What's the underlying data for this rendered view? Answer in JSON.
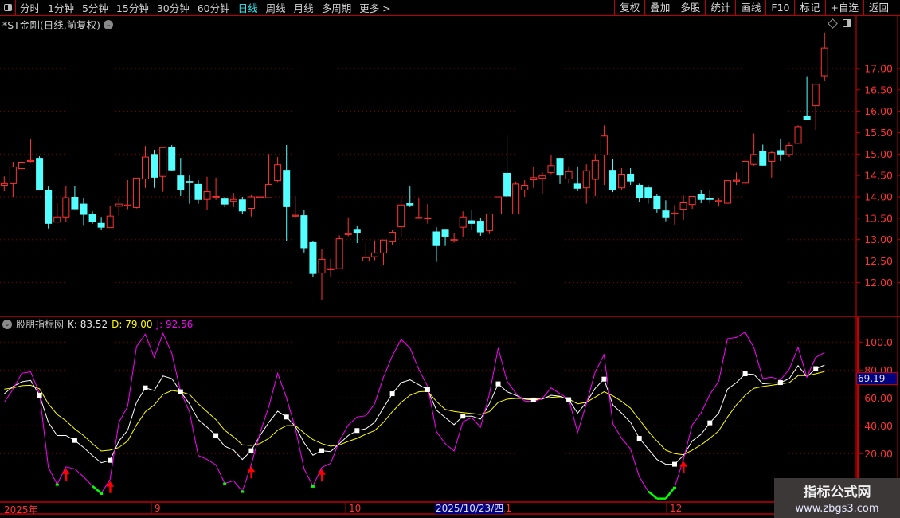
{
  "toolbar": {
    "periods": [
      "分时",
      "1分钟",
      "5分钟",
      "15分钟",
      "30分钟",
      "60分钟",
      "日线",
      "周线",
      "月线",
      "多周期",
      "更多 >"
    ],
    "active_period": "日线",
    "buttons": [
      "复权",
      "叠加",
      "多股",
      "统计",
      "画线",
      "F10",
      "标记",
      "+自选",
      "返回"
    ]
  },
  "chart_title": "*ST金刚(日线,前复权)",
  "indicator": {
    "name": "股朋指标网",
    "k_label": "K: 83.52",
    "d_label": "D: 79.00",
    "j_label": "J: 92.56"
  },
  "price_axis": [
    "17.00",
    "16.50",
    "16.00",
    "15.50",
    "15.00",
    "14.50",
    "14.00",
    "13.50",
    "13.00",
    "12.50",
    "12.00"
  ],
  "indicator_axis": [
    "100.0",
    "80.00",
    "60.00",
    "40.00",
    "20.00"
  ],
  "crosshair_value": "69.19",
  "date_axis": {
    "labels": [
      "2025年",
      "9",
      "10",
      "11",
      "12"
    ],
    "crosshair_date": "2025/10/23/四"
  },
  "watermark": {
    "title": "指标公式网",
    "url": "www.zbgs3.com"
  },
  "colors": {
    "up": "#ff3333",
    "down": "#54ffff",
    "k": "#ffffff",
    "d": "#ffff00",
    "j": "#ff00ff",
    "j_low": "#00ff00",
    "signal": "#ff0000",
    "grid": "#8b0000"
  },
  "chart_data": {
    "type": "candlestick+kdj",
    "ohlc": [
      [
        14.27,
        14.48,
        14.13,
        14.31
      ],
      [
        14.31,
        14.82,
        14.0,
        14.7
      ],
      [
        14.66,
        14.97,
        14.43,
        14.81
      ],
      [
        14.85,
        15.34,
        14.81,
        14.85
      ],
      [
        14.91,
        14.95,
        14.15,
        14.15
      ],
      [
        14.15,
        14.24,
        13.26,
        13.37
      ],
      [
        13.41,
        13.85,
        13.41,
        13.53
      ],
      [
        13.53,
        14.26,
        13.41,
        13.98
      ],
      [
        14.0,
        14.26,
        13.71,
        13.71
      ],
      [
        13.84,
        13.98,
        13.34,
        13.58
      ],
      [
        13.59,
        13.66,
        13.37,
        13.41
      ],
      [
        13.39,
        13.53,
        13.22,
        13.28
      ],
      [
        13.28,
        13.78,
        13.28,
        13.55
      ],
      [
        13.78,
        13.96,
        13.56,
        13.83
      ],
      [
        13.81,
        14.39,
        13.71,
        13.81
      ],
      [
        13.75,
        14.44,
        13.73,
        14.44
      ],
      [
        14.42,
        15.19,
        14.21,
        14.93
      ],
      [
        15.0,
        15.1,
        14.21,
        14.45
      ],
      [
        14.48,
        15.15,
        14.12,
        15.15
      ],
      [
        15.16,
        15.21,
        14.6,
        14.62
      ],
      [
        14.5,
        14.91,
        14.02,
        14.16
      ],
      [
        14.37,
        14.5,
        13.84,
        14.32
      ],
      [
        14.3,
        14.39,
        13.84,
        13.93
      ],
      [
        13.94,
        14.47,
        13.69,
        14.12
      ],
      [
        14.01,
        14.45,
        13.93,
        14.01
      ],
      [
        13.96,
        14.0,
        13.76,
        13.82
      ],
      [
        13.9,
        14.09,
        13.76,
        13.94
      ],
      [
        13.94,
        14.0,
        13.6,
        13.66
      ],
      [
        13.73,
        14.04,
        13.54,
        14.0
      ],
      [
        14.0,
        14.11,
        13.82,
        14.0
      ],
      [
        13.98,
        15.0,
        13.98,
        14.29
      ],
      [
        14.38,
        14.93,
        14.33,
        14.75
      ],
      [
        14.63,
        15.21,
        12.96,
        13.76
      ],
      [
        13.57,
        14.02,
        13.5,
        13.57
      ],
      [
        13.57,
        13.7,
        12.7,
        12.8
      ],
      [
        12.94,
        12.97,
        12.13,
        12.2
      ],
      [
        12.22,
        12.79,
        11.58,
        12.54
      ],
      [
        12.32,
        12.55,
        12.14,
        12.32
      ],
      [
        12.32,
        13.1,
        12.32,
        13.02
      ],
      [
        13.14,
        13.52,
        13.08,
        13.14
      ],
      [
        13.25,
        13.31,
        12.92,
        13.15
      ],
      [
        12.5,
        12.94,
        12.5,
        12.58
      ],
      [
        12.6,
        12.98,
        12.52,
        12.69
      ],
      [
        12.69,
        12.99,
        12.41,
        12.99
      ],
      [
        12.95,
        13.23,
        12.87,
        13.17
      ],
      [
        13.3,
        14.0,
        13.07,
        13.81
      ],
      [
        13.85,
        14.24,
        13.76,
        13.8
      ],
      [
        13.52,
        13.96,
        13.52,
        13.52
      ],
      [
        13.51,
        13.83,
        13.37,
        13.51
      ],
      [
        13.19,
        13.29,
        12.48,
        12.85
      ],
      [
        13.25,
        13.25,
        12.85,
        13.07
      ],
      [
        13.0,
        13.16,
        12.93,
        13.0
      ],
      [
        13.29,
        13.66,
        13.07,
        13.53
      ],
      [
        13.45,
        13.7,
        13.22,
        13.37
      ],
      [
        13.44,
        13.5,
        13.09,
        13.17
      ],
      [
        13.21,
        13.6,
        13.13,
        13.6
      ],
      [
        13.6,
        14.0,
        13.6,
        14.0
      ],
      [
        14.56,
        15.43,
        14.01,
        14.01
      ],
      [
        13.6,
        14.34,
        13.6,
        14.3
      ],
      [
        14.16,
        14.39,
        14.0,
        14.27
      ],
      [
        14.4,
        14.69,
        14.21,
        14.45
      ],
      [
        14.44,
        14.58,
        14.06,
        14.49
      ],
      [
        14.57,
        14.98,
        14.53,
        14.73
      ],
      [
        14.91,
        14.91,
        14.3,
        14.5
      ],
      [
        14.42,
        14.7,
        14.31,
        14.59
      ],
      [
        14.31,
        14.71,
        14.13,
        14.19
      ],
      [
        14.21,
        14.76,
        13.84,
        14.61
      ],
      [
        14.41,
        15.0,
        14.02,
        14.85
      ],
      [
        14.98,
        15.67,
        14.28,
        15.42
      ],
      [
        14.63,
        14.89,
        14.11,
        14.15
      ],
      [
        14.21,
        14.67,
        14.17,
        14.53
      ],
      [
        14.54,
        14.67,
        14.28,
        14.36
      ],
      [
        14.28,
        14.31,
        13.88,
        13.97
      ],
      [
        14.22,
        14.28,
        13.84,
        13.97
      ],
      [
        14.02,
        14.06,
        13.63,
        13.72
      ],
      [
        13.68,
        13.92,
        13.43,
        13.52
      ],
      [
        13.62,
        13.81,
        13.35,
        13.62
      ],
      [
        13.71,
        14.03,
        13.46,
        13.86
      ],
      [
        13.82,
        14.01,
        13.72,
        14.01
      ],
      [
        14.07,
        14.16,
        13.85,
        13.93
      ],
      [
        13.98,
        14.15,
        13.85,
        13.93
      ],
      [
        13.91,
        13.98,
        13.77,
        13.91
      ],
      [
        13.85,
        14.38,
        13.84,
        14.38
      ],
      [
        14.39,
        14.57,
        14.28,
        14.39
      ],
      [
        14.32,
        14.98,
        14.26,
        14.83
      ],
      [
        14.76,
        15.48,
        14.73,
        14.99
      ],
      [
        15.07,
        15.22,
        14.73,
        14.73
      ],
      [
        14.83,
        15.07,
        14.45,
        15.03
      ],
      [
        15.09,
        15.35,
        14.84,
        14.99
      ],
      [
        14.99,
        15.28,
        14.93,
        15.2
      ],
      [
        15.25,
        15.67,
        15.25,
        15.64
      ],
      [
        15.9,
        16.82,
        15.79,
        15.8
      ],
      [
        16.13,
        16.65,
        15.56,
        16.63
      ],
      [
        16.83,
        17.84,
        16.7,
        17.48
      ]
    ],
    "k": [
      63,
      68.2,
      71.6,
      72.6,
      61.9,
      42.5,
      33,
      33,
      29.5,
      24.4,
      18.7,
      13.5,
      15.2,
      29.1,
      36.8,
      56.8,
      67.2,
      65.3,
      75.8,
      73.9,
      64.4,
      55.8,
      44.4,
      39,
      33,
      25.3,
      22.5,
      15.8,
      22.1,
      33,
      42.5,
      50.5,
      46.3,
      39.6,
      27.8,
      18.9,
      22.1,
      21.5,
      27.2,
      33,
      36.6,
      37.9,
      42.5,
      53,
      63,
      71,
      73,
      69.5,
      65.9,
      51.2,
      45.9,
      40.8,
      46.9,
      46.9,
      44.8,
      55.8,
      70.1,
      64.4,
      61.9,
      59.1,
      58.5,
      59.2,
      61.9,
      61.2,
      58.7,
      49.1,
      56.8,
      66.9,
      73.5,
      54.9,
      49.1,
      42.5,
      31,
      23.4,
      15.8,
      12.4,
      12.4,
      18.7,
      29.1,
      33.9,
      42.1,
      49.1,
      66.3,
      71,
      77.3,
      76.8,
      70.1,
      70.7,
      71,
      73.9,
      83.2,
      75.2,
      81,
      83.52
    ],
    "d": [
      66.3,
      67.2,
      68.8,
      69.1,
      66.5,
      55.8,
      48.2,
      43.6,
      37.7,
      33,
      27.2,
      21.9,
      22.5,
      24.4,
      29.1,
      40.6,
      50.1,
      54.9,
      62.5,
      65.3,
      64.4,
      62.5,
      55.8,
      50.1,
      44.4,
      36.8,
      32,
      26.3,
      25.9,
      27.2,
      31,
      36.8,
      40.1,
      40.2,
      34.9,
      30.1,
      27.2,
      25.3,
      26.3,
      28.8,
      31,
      34,
      36.6,
      42.5,
      50.1,
      56.8,
      61.9,
      64.4,
      64.8,
      57.5,
      51.7,
      50.3,
      49.5,
      48.8,
      48.2,
      50.1,
      56.8,
      59.1,
      59.6,
      59.6,
      59.2,
      59.6,
      60.4,
      60.8,
      59.2,
      55.8,
      56.8,
      60.6,
      64.4,
      61.5,
      57.5,
      52.7,
      44.4,
      36.2,
      29.1,
      22.5,
      20,
      19.2,
      22.5,
      26.3,
      31,
      36.4,
      46.3,
      54.9,
      61.9,
      66.9,
      68.2,
      69.1,
      70.1,
      71,
      76,
      76,
      77.3,
      79.0
    ],
    "j": [
      56.8,
      66.3,
      77.7,
      78.7,
      63.4,
      10.1,
      -1.9,
      10.5,
      9.1,
      3.4,
      -3.2,
      -8.4,
      1.5,
      42.5,
      53.9,
      96.8,
      105.7,
      89.1,
      106.3,
      92,
      64.4,
      50.1,
      18.7,
      15.8,
      12,
      -1.3,
      0.6,
      -7,
      12,
      34.9,
      53.9,
      77.7,
      60,
      38.3,
      9.1,
      -3.2,
      10.1,
      13,
      29.1,
      40.6,
      46.3,
      47.2,
      55.8,
      74.9,
      90.1,
      101.9,
      95.8,
      80.6,
      68.2,
      35.8,
      27.2,
      21.9,
      42.9,
      45.9,
      39,
      62.5,
      95.8,
      72,
      63.4,
      57.7,
      57.3,
      59.6,
      67.2,
      63,
      59.2,
      35.2,
      55.8,
      78.7,
      91,
      41.5,
      31,
      23.4,
      3.4,
      -7,
      -12.2,
      -12.2,
      -4.2,
      15.8,
      40.6,
      49.1,
      62.5,
      72,
      102.5,
      103.4,
      107.2,
      95.8,
      73.9,
      74.9,
      73,
      80.6,
      96.2,
      74.9,
      89.1,
      92.56
    ],
    "buy_signals": [
      7,
      12,
      28,
      36,
      77
    ],
    "price_range": [
      11.4,
      18.1
    ],
    "indicator_range": [
      0,
      110
    ]
  }
}
